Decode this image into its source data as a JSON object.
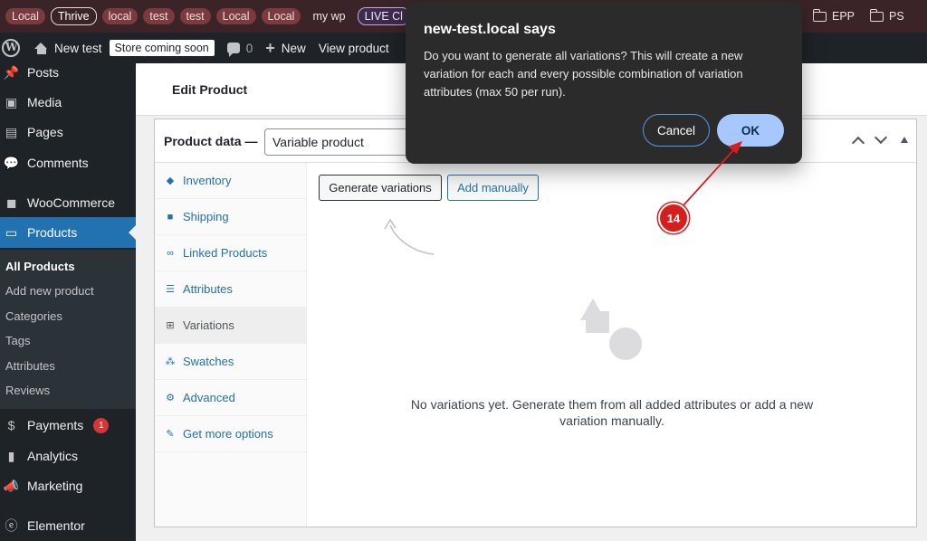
{
  "bookmarks": {
    "items": [
      {
        "label": "Local",
        "style": "red"
      },
      {
        "label": "Thrive",
        "style": "outline"
      },
      {
        "label": "local",
        "style": "red"
      },
      {
        "label": "test",
        "style": "red"
      },
      {
        "label": "test",
        "style": "red"
      },
      {
        "label": "Local",
        "style": "red"
      },
      {
        "label": "Local",
        "style": "red"
      },
      {
        "label": "my wp",
        "style": "plain"
      },
      {
        "label": "LIVE Cl",
        "style": "purple"
      }
    ],
    "folders": [
      {
        "label": "EPP",
        "icon": "folder-icon"
      },
      {
        "label": "PS",
        "icon": "folder-icon"
      }
    ]
  },
  "adminbar": {
    "site_name": "New test",
    "store_status": "Store coming soon",
    "comment_count": "0",
    "new_label": "New",
    "view_product": "View product"
  },
  "sidebar": {
    "items": [
      {
        "label": "Posts",
        "icon": "pin-icon"
      },
      {
        "label": "Media",
        "icon": "media-icon"
      },
      {
        "label": "Pages",
        "icon": "pages-icon"
      },
      {
        "label": "Comments",
        "icon": "comments-icon"
      },
      {
        "label": "WooCommerce",
        "icon": "woo-icon"
      },
      {
        "label": "Products",
        "icon": "products-icon"
      },
      {
        "label": "Payments",
        "icon": "payments-icon",
        "badge": "1"
      },
      {
        "label": "Analytics",
        "icon": "analytics-icon"
      },
      {
        "label": "Marketing",
        "icon": "megaphone-icon"
      },
      {
        "label": "Elementor",
        "icon": "elementor-icon"
      }
    ],
    "submenu": [
      "All Products",
      "Add new product",
      "Categories",
      "Tags",
      "Attributes",
      "Reviews"
    ]
  },
  "page": {
    "title": "Edit Product"
  },
  "product_data": {
    "label": "Product data —",
    "type_value": "Variable product",
    "tabs": [
      {
        "label": "Inventory",
        "icon": "tag-icon"
      },
      {
        "label": "Shipping",
        "icon": "truck-icon"
      },
      {
        "label": "Linked Products",
        "icon": "link-icon"
      },
      {
        "label": "Attributes",
        "icon": "list-icon"
      },
      {
        "label": "Variations",
        "icon": "grid-icon"
      },
      {
        "label": "Swatches",
        "icon": "swatches-icon"
      },
      {
        "label": "Advanced",
        "icon": "gear-icon"
      },
      {
        "label": "Get more options",
        "icon": "plugin-icon"
      }
    ],
    "generate_btn": "Generate variations",
    "add_manually_btn": "Add manually",
    "empty_message": "No variations yet. Generate them from all added attributes or add a new variation manually."
  },
  "dialog": {
    "title": "new-test.local says",
    "message": "Do you want to generate all variations? This will create a new variation for each and every possible combination of variation attributes (max 50 per run).",
    "cancel": "Cancel",
    "ok": "OK"
  },
  "annotation": {
    "step": "14",
    "color": "#d51f1f"
  }
}
